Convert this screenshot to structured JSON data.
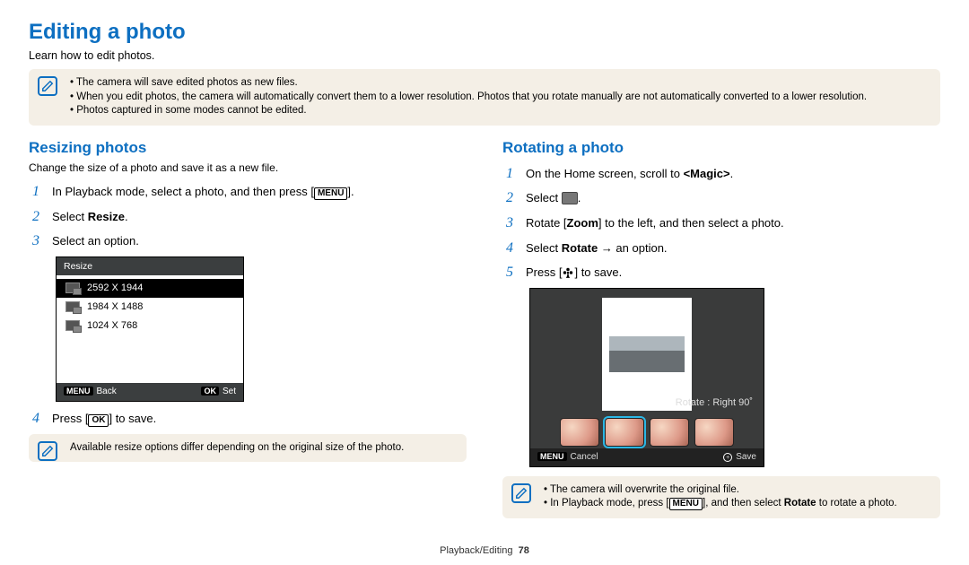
{
  "page": {
    "title": "Editing a photo",
    "subtitle": "Learn how to edit photos.",
    "footer_section": "Playback/Editing",
    "footer_page": "78"
  },
  "top_note": {
    "items": [
      "The camera will save edited photos as new files.",
      "When you edit photos, the camera will automatically convert them to a lower resolution. Photos that you rotate manually are not automatically converted to a lower resolution.",
      "Photos captured in some modes cannot be edited."
    ]
  },
  "resize": {
    "title": "Resizing photos",
    "subtitle": "Change the size of a photo and save it as a new file.",
    "step1_pre": "In Playback mode, select a photo, and then press [",
    "step1_btn": "MENU",
    "step1_post": "].",
    "step2_pre": "Select ",
    "step2_bold": "Resize",
    "step2_post": ".",
    "step3": "Select an option.",
    "menu": {
      "title": "Resize",
      "options": [
        "2592 X 1944",
        "1984 X 1488",
        "1024 X 768"
      ],
      "back_key": "MENU",
      "back_label": "Back",
      "set_key": "OK",
      "set_label": "Set"
    },
    "step4_pre": "Press [",
    "step4_btn": "OK",
    "step4_post": "] to save.",
    "note": "Available resize options differ depending on the original size of the photo."
  },
  "rotate": {
    "title": "Rotating a photo",
    "step1_pre": "On the Home screen, scroll to ",
    "step1_bold": "<Magic>",
    "step1_post": ".",
    "step2_pre": "Select ",
    "step2_post": ".",
    "step3_pre": "Rotate [",
    "step3_bold": "Zoom",
    "step3_post": "] to the left, and then select a photo.",
    "step4_pre": "Select ",
    "step4_bold": "Rotate",
    "step4_post": " → an option.",
    "step5_pre": "Press [",
    "step5_post": "] to save.",
    "shot": {
      "caption": "Rotate : Right 90˚",
      "cancel_key": "MENU",
      "cancel_label": "Cancel",
      "save_label": "Save"
    },
    "note": {
      "item1": "The camera will overwrite the original file.",
      "item2_pre": "In Playback mode, press [",
      "item2_btn": "MENU",
      "item2_mid": "], and then select ",
      "item2_bold": "Rotate",
      "item2_post": " to rotate a photo."
    }
  }
}
